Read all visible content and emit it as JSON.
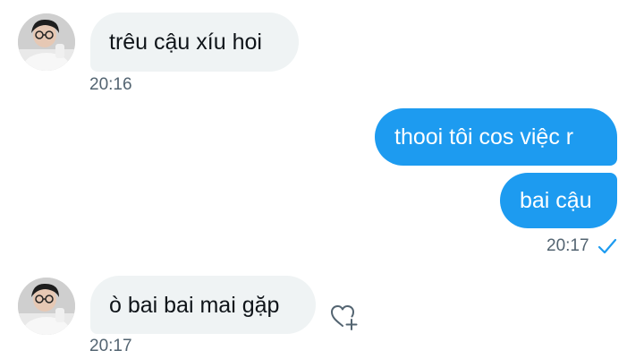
{
  "conversation": {
    "messages": [
      {
        "direction": "incoming",
        "text": "trêu cậu xíu hoi"
      },
      {
        "direction": "outgoing",
        "text": "thooi tôi cos việc r"
      },
      {
        "direction": "outgoing",
        "text": "bai cậu"
      },
      {
        "direction": "incoming",
        "text": "ò bai bai mai gặp"
      }
    ],
    "timestamps": [
      "20:16",
      "20:17",
      "20:17"
    ],
    "read_receipt_icon": "check-icon",
    "react_icon": "heart-plus-icon"
  },
  "colors": {
    "outgoing_bubble": "#1d9bf0",
    "incoming_bubble": "#eff3f4",
    "timestamp": "#536471",
    "check": "#1d9bf0"
  }
}
